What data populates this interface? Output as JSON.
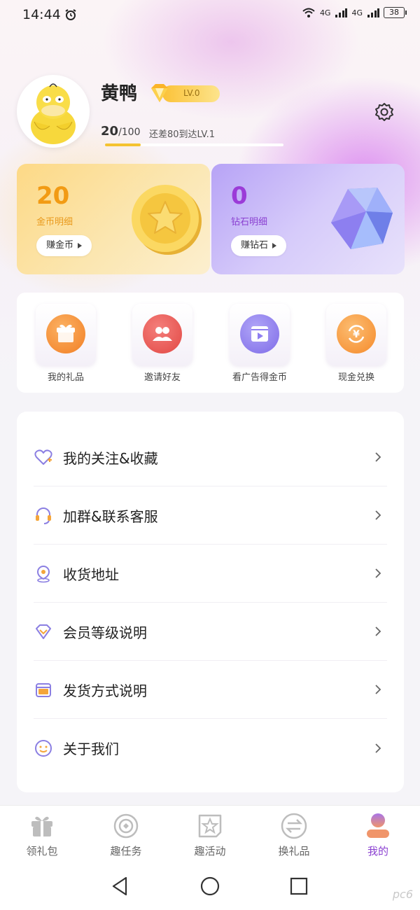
{
  "status_bar": {
    "time": "14:44",
    "network1": "4G",
    "network2": "4G",
    "battery": "38"
  },
  "profile": {
    "username": "黄鸭",
    "level": "LV.0",
    "points_current": "20",
    "points_total": "/100",
    "progress_hint": "还差80到达LV.1",
    "progress_fraction": 0.2
  },
  "coin_card": {
    "value": "20",
    "label": "金币明细",
    "button": "赚金币"
  },
  "diamond_card": {
    "value": "0",
    "label": "钻石明细",
    "button": "赚钻石"
  },
  "quick_actions": [
    {
      "label": "我的礼品",
      "icon": "gift-icon",
      "color": "#f7963a"
    },
    {
      "label": "邀请好友",
      "icon": "friends-icon",
      "color": "#ec5b57"
    },
    {
      "label": "看广告得金币",
      "icon": "video-icon",
      "color": "#8f7ef1"
    },
    {
      "label": "现金兑换",
      "icon": "cash-exchange-icon",
      "color": "#f89a3a"
    }
  ],
  "menu": [
    {
      "label": "我的关注&收藏",
      "icon": "heart-icon"
    },
    {
      "label": "加群&联系客服",
      "icon": "headset-icon"
    },
    {
      "label": "收货地址",
      "icon": "location-icon"
    },
    {
      "label": "会员等级说明",
      "icon": "diamond-icon"
    },
    {
      "label": "发货方式说明",
      "icon": "box-icon"
    },
    {
      "label": "关于我们",
      "icon": "smile-icon"
    }
  ],
  "bottom_nav": [
    {
      "label": "领礼包",
      "icon": "gift-icon"
    },
    {
      "label": "趣任务",
      "icon": "target-icon"
    },
    {
      "label": "趣活动",
      "icon": "star-flag-icon"
    },
    {
      "label": "换礼品",
      "icon": "exchange-icon"
    },
    {
      "label": "我的",
      "icon": "user-icon"
    }
  ],
  "active_tab": "我的",
  "watermark": "pc6",
  "colors": {
    "accent": "#8b41d1",
    "coin": "#f29b14",
    "gold": "#f4c330"
  }
}
